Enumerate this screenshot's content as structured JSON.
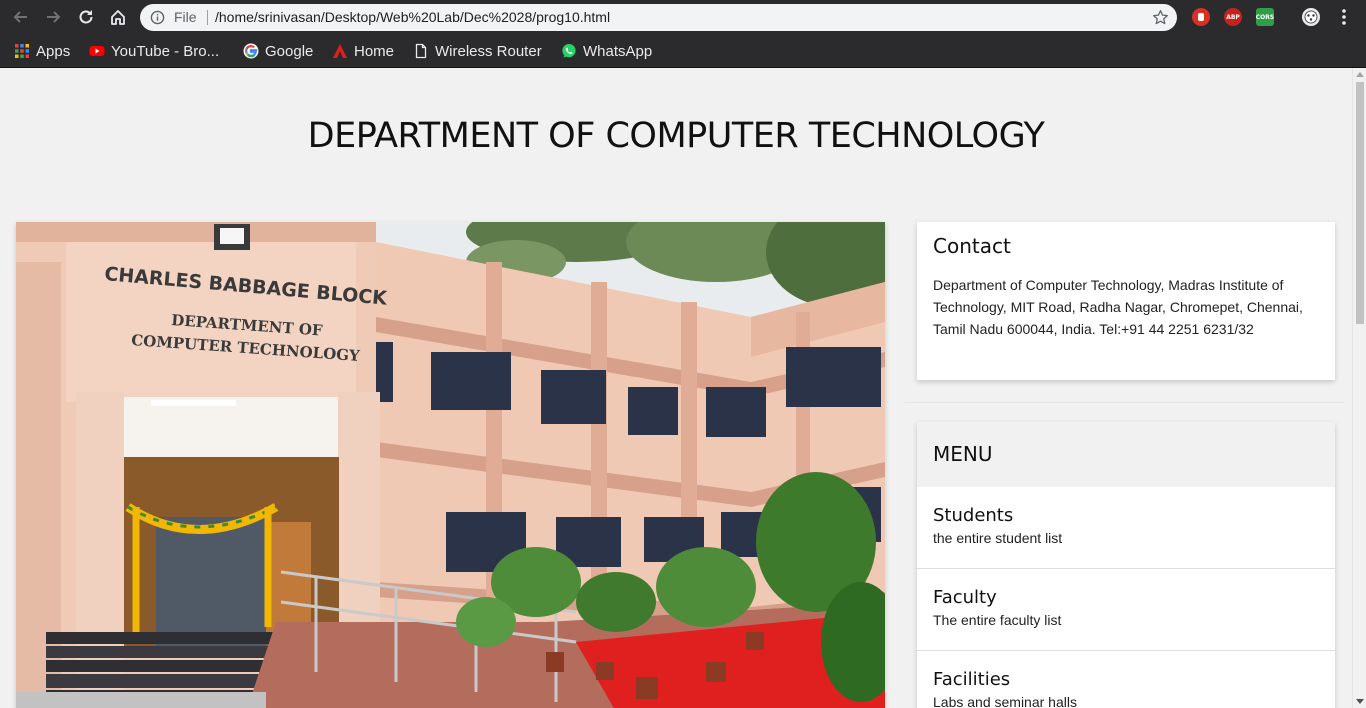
{
  "browser": {
    "address": {
      "scheme_label": "File",
      "url": "/home/srinivasan/Desktop/Web%20Lab/Dec%2028/prog10.html"
    },
    "extensions": [
      {
        "name": "stop-extension-icon",
        "label": "",
        "color": "#d93025"
      },
      {
        "name": "adblock-plus-icon",
        "label": "ABP",
        "color": "#c5221f"
      },
      {
        "name": "cors-extension-icon",
        "label": "CORS",
        "color": "#2e9e49"
      }
    ],
    "bookmarks": [
      {
        "label": "Apps",
        "icon": "apps-grid-icon"
      },
      {
        "label": "YouTube - Bro...",
        "icon": "youtube-icon"
      },
      {
        "label": "Google",
        "icon": "google-icon"
      },
      {
        "label": "Home",
        "icon": "home-red-icon"
      },
      {
        "label": "Wireless Router",
        "icon": "page-icon"
      },
      {
        "label": "WhatsApp",
        "icon": "whatsapp-icon"
      }
    ]
  },
  "page": {
    "title": "DEPARTMENT OF COMPUTER TECHNOLOGY",
    "hero_sign": {
      "block_name": "CHARLES BABBAGE BLOCK",
      "dept_line1": "DEPARTMENT OF",
      "dept_line2": "COMPUTER TECHNOLOGY"
    },
    "contact": {
      "title": "Contact",
      "body": "Department of Computer Technology, Madras Institute of Technology, MIT Road, Radha Nagar, Chromepet, Chennai, Tamil Nadu 600044, India. Tel:+91 44 2251 6231/32"
    },
    "menu": {
      "heading": "MENU",
      "items": [
        {
          "title": "Students",
          "subtitle": "the entire student list"
        },
        {
          "title": "Faculty",
          "subtitle": "The entire faculty list"
        },
        {
          "title": "Facilities",
          "subtitle": "Labs and seminar halls"
        }
      ]
    }
  },
  "colors": {
    "chrome_dark": "#2b2b2d",
    "page_bg": "#f1f1f1",
    "accent_red": "#e01f1f"
  }
}
